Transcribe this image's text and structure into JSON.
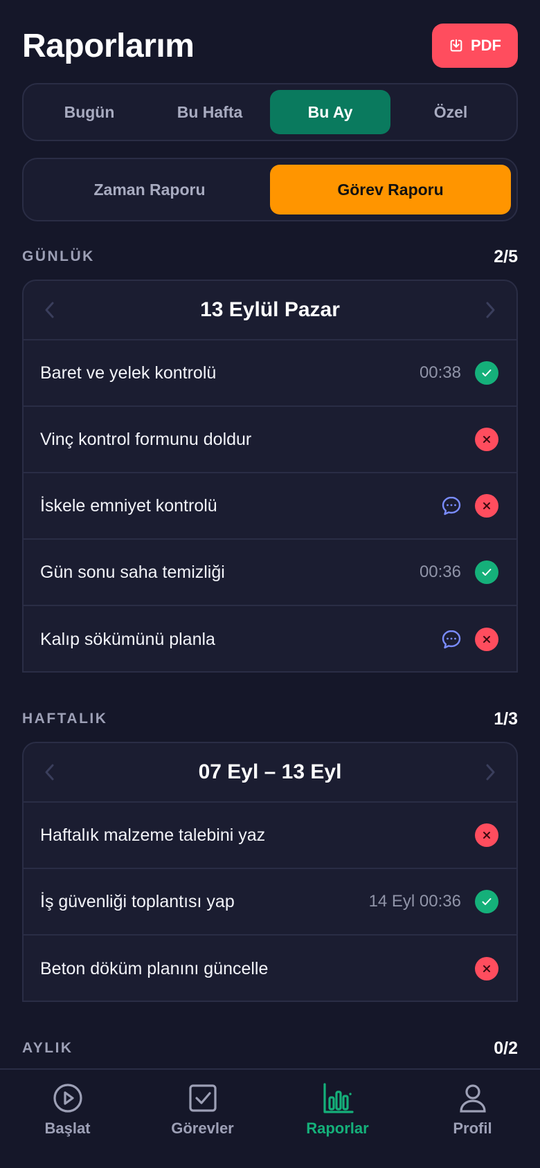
{
  "header": {
    "title": "Raporlarım",
    "pdf_label": "PDF"
  },
  "period_tabs": [
    "Bugün",
    "Bu Hafta",
    "Bu Ay",
    "Özel"
  ],
  "period_active": "Bu Ay",
  "report_tabs": [
    "Zaman Raporu",
    "Görev Raporu"
  ],
  "report_active": "Görev Raporu",
  "daily": {
    "label": "GÜNLÜK",
    "count": "2/5",
    "date": "13 Eylül Pazar",
    "tasks": [
      {
        "name": "Baret ve yelek kontrolü",
        "time": "00:38",
        "status": "done",
        "comment": false
      },
      {
        "name": "Vinç kontrol formunu doldur",
        "time": "",
        "status": "missed",
        "comment": false
      },
      {
        "name": "İskele emniyet kontrolü",
        "time": "",
        "status": "missed",
        "comment": true
      },
      {
        "name": "Gün sonu saha temizliği",
        "time": "00:36",
        "status": "done",
        "comment": false
      },
      {
        "name": "Kalıp sökümünü planla",
        "time": "",
        "status": "missed",
        "comment": true
      }
    ]
  },
  "weekly": {
    "label": "HAFTALIK",
    "count": "1/3",
    "date": "07 Eyl – 13 Eyl",
    "tasks": [
      {
        "name": "Haftalık malzeme talebini yaz",
        "time": "",
        "status": "missed",
        "comment": false
      },
      {
        "name": "İş güvenliği toplantısı yap",
        "time": "14 Eyl 00:36",
        "status": "done",
        "comment": false
      },
      {
        "name": "Beton döküm planını güncelle",
        "time": "",
        "status": "missed",
        "comment": false
      }
    ]
  },
  "monthly": {
    "label": "AYLIK",
    "count": "0/2"
  },
  "nav": [
    {
      "label": "Başlat",
      "icon": "play-icon",
      "active": false
    },
    {
      "label": "Görevler",
      "icon": "checkbox-icon",
      "active": false
    },
    {
      "label": "Raporlar",
      "icon": "bar-chart-icon",
      "active": true
    },
    {
      "label": "Profil",
      "icon": "user-icon",
      "active": false
    }
  ],
  "colors": {
    "bg": "#151729",
    "accent_green": "#0a7a5e",
    "accent_orange": "#ff9500",
    "danger": "#ff4d5e",
    "success": "#15b07a"
  }
}
